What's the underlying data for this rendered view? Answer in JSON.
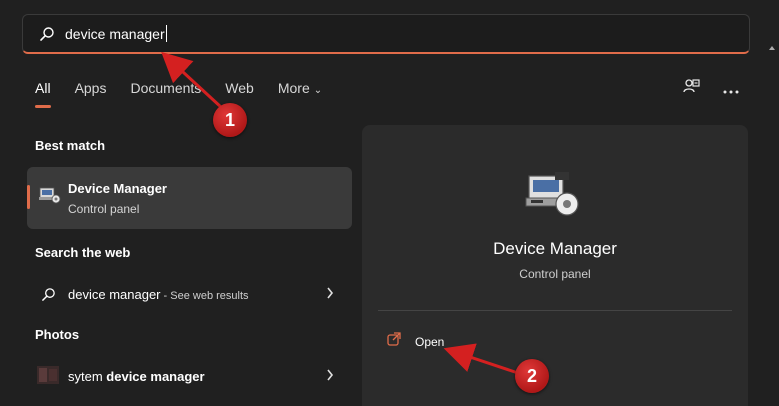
{
  "search": {
    "value": "device manager"
  },
  "tabs": [
    {
      "label": "All",
      "active": true
    },
    {
      "label": "Apps",
      "active": false
    },
    {
      "label": "Documents",
      "active": false
    },
    {
      "label": "Web",
      "active": false
    },
    {
      "label": "More",
      "active": false
    }
  ],
  "sections": {
    "best_match": "Best match",
    "search_web": "Search the web",
    "photos": "Photos"
  },
  "best_match_item": {
    "title": "Device Manager",
    "subtitle": "Control panel"
  },
  "web_result": {
    "query": "device manager",
    "suffix": " - See web results"
  },
  "photo_result": {
    "prefix": "sytem ",
    "bold": "device manager"
  },
  "detail": {
    "title": "Device Manager",
    "subtitle": "Control panel",
    "open_label": "Open"
  },
  "annotations": {
    "step1": "1",
    "step2": "2"
  },
  "colors": {
    "accent": "#e06c4a",
    "annotation_red": "#d42020",
    "background": "#202020",
    "panel": "#2b2b2b"
  }
}
